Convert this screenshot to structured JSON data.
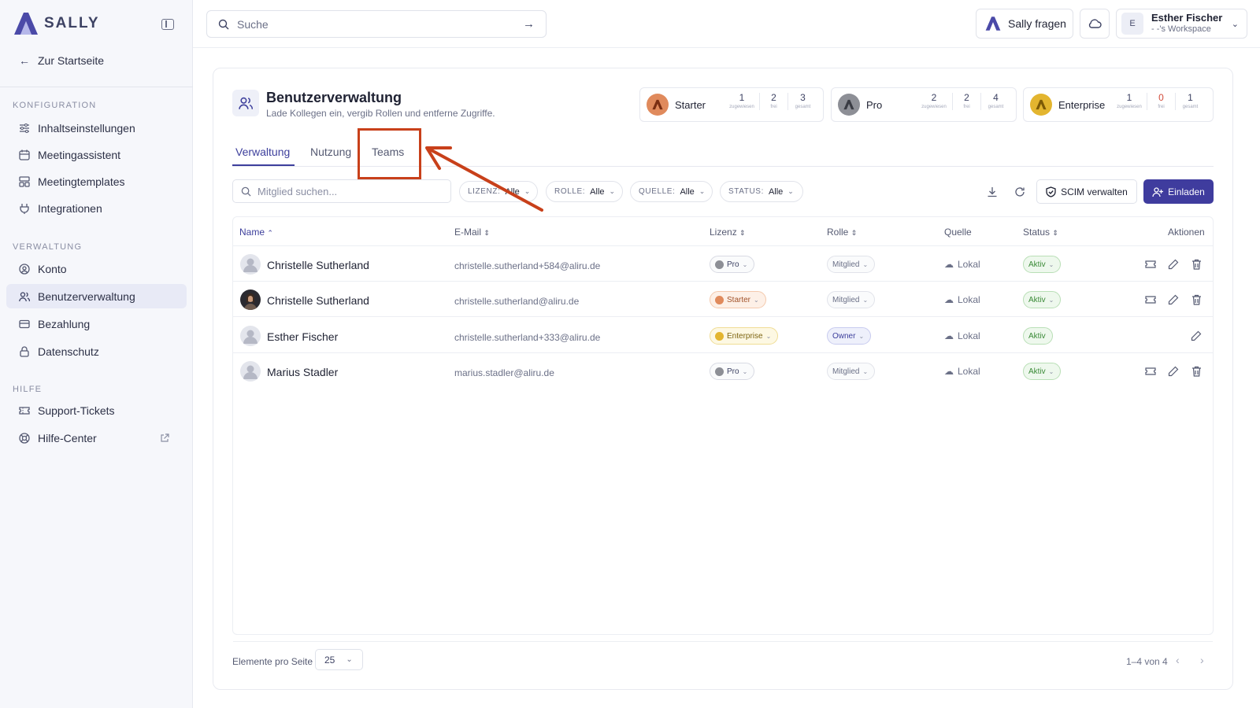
{
  "brand": {
    "name": "SALLY",
    "accent": "#3f3c9e"
  },
  "sidebar": {
    "back_label": "Zur Startseite",
    "sections": [
      {
        "title": "KONFIGURATION",
        "items": [
          {
            "label": "Inhaltseinstellungen",
            "icon": "sliders-icon"
          },
          {
            "label": "Meetingassistent",
            "icon": "calendar-icon"
          },
          {
            "label": "Meetingtemplates",
            "icon": "template-icon"
          },
          {
            "label": "Integrationen",
            "icon": "plug-icon"
          }
        ]
      },
      {
        "title": "VERWALTUNG",
        "items": [
          {
            "label": "Konto",
            "icon": "user-circle-icon"
          },
          {
            "label": "Benutzerverwaltung",
            "icon": "users-icon",
            "active": true
          },
          {
            "label": "Bezahlung",
            "icon": "credit-card-icon"
          },
          {
            "label": "Datenschutz",
            "icon": "lock-icon"
          }
        ]
      },
      {
        "title": "HILFE",
        "items": [
          {
            "label": "Support-Tickets",
            "icon": "ticket-icon"
          },
          {
            "label": "Hilfe-Center",
            "icon": "lifebuoy-icon",
            "external": true
          }
        ]
      }
    ]
  },
  "topbar": {
    "search_placeholder": "Suche",
    "ask_label": "Sally fragen",
    "user": {
      "initial": "E",
      "name": "Esther Fischer",
      "workspace": "- -'s Workspace"
    }
  },
  "page": {
    "title": "Benutzerverwaltung",
    "subtitle": "Lade Kollegen ein, vergib Rollen und entferne Zugriffe."
  },
  "plans": [
    {
      "name": "Starter",
      "assigned": "1",
      "free": "2",
      "total": "3",
      "color": "#e08a5c",
      "free_red": false
    },
    {
      "name": "Pro",
      "assigned": "2",
      "free": "2",
      "total": "4",
      "color": "#8d8f96",
      "free_red": false
    },
    {
      "name": "Enterprise",
      "assigned": "1",
      "free": "0",
      "total": "1",
      "color": "#e3b52f",
      "free_red": true
    }
  ],
  "plan_labels": {
    "assigned": "zugewiesen",
    "free": "frei",
    "total": "gesamt"
  },
  "tabs": [
    "Verwaltung",
    "Nutzung",
    "Teams"
  ],
  "filters": {
    "member_search_placeholder": "Mitglied suchen...",
    "items": [
      {
        "key": "LIZENZ:",
        "value": "Alle"
      },
      {
        "key": "ROLLE:",
        "value": "Alle"
      },
      {
        "key": "QUELLE:",
        "value": "Alle"
      },
      {
        "key": "STATUS:",
        "value": "Alle"
      }
    ],
    "scim_label": "SCIM verwalten",
    "invite_label": "Einladen"
  },
  "table": {
    "columns": [
      "Name",
      "E-Mail",
      "Lizenz",
      "Rolle",
      "Quelle",
      "Status",
      "Aktionen"
    ],
    "rows": [
      {
        "name": "Christelle Sutherland",
        "email": "christelle.sutherland+584@aliru.de",
        "license": "Pro",
        "role": "Mitglied",
        "source": "Lokal",
        "status": "Aktiv",
        "photo": false,
        "owner": false
      },
      {
        "name": "Christelle Sutherland",
        "email": "christelle.sutherland@aliru.de",
        "license": "Starter",
        "role": "Mitglied",
        "source": "Lokal",
        "status": "Aktiv",
        "photo": true,
        "owner": false
      },
      {
        "name": "Esther Fischer",
        "email": "christelle.sutherland+333@aliru.de",
        "license": "Enterprise",
        "role": "Owner",
        "source": "Lokal",
        "status": "Aktiv",
        "photo": false,
        "owner": true
      },
      {
        "name": "Marius Stadler",
        "email": "marius.stadler@aliru.de",
        "license": "Pro",
        "role": "Mitglied",
        "source": "Lokal",
        "status": "Aktiv",
        "photo": false,
        "owner": false
      }
    ]
  },
  "footer": {
    "per_page_label": "Elemente pro Seite",
    "per_page_value": "25",
    "range": "1–4 von 4"
  },
  "annotation": {
    "color": "#c8401a"
  }
}
